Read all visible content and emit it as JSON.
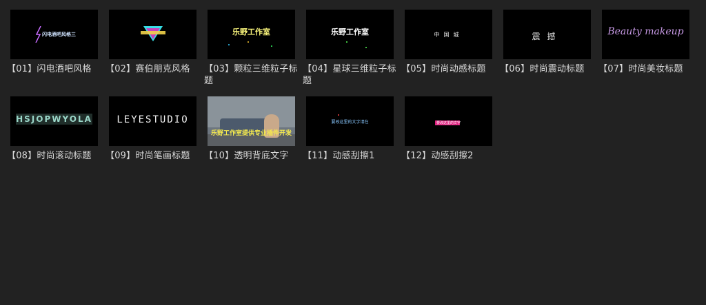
{
  "tiles": [
    {
      "label": "【01】闪电酒吧风格",
      "thumb_text": "闪电酒吧风格三"
    },
    {
      "label": "【02】赛伯朋克风格",
      "thumb_text": ""
    },
    {
      "label": "【03】颗粒三维粒子标题",
      "thumb_text": "乐野工作室"
    },
    {
      "label": "【04】星球三维粒子标题",
      "thumb_text": "乐野工作室"
    },
    {
      "label": "【05】时尚动感标题",
      "thumb_text": "中国城"
    },
    {
      "label": "【06】时尚震动标题",
      "thumb_text": "震撼"
    },
    {
      "label": "【07】时尚美妆标题",
      "thumb_text": "Beauty makeup"
    },
    {
      "label": "【08】时尚滚动标题",
      "thumb_text": "HSJOPWYOLA"
    },
    {
      "label": "【09】时尚笔画标题",
      "thumb_text": "LEYESTUDIO"
    },
    {
      "label": "【10】透明背底文字",
      "thumb_text": "乐野工作室提供专业插件开发"
    },
    {
      "label": "【11】动感刮擦1",
      "thumb_text": "要改这里的文字请在"
    },
    {
      "label": "【12】动感刮擦2",
      "thumb_text": "要改这里的文字"
    }
  ],
  "colors": {
    "background": "#222222",
    "label_text": "#d8d8d8",
    "thumb_bg": "#000000"
  }
}
